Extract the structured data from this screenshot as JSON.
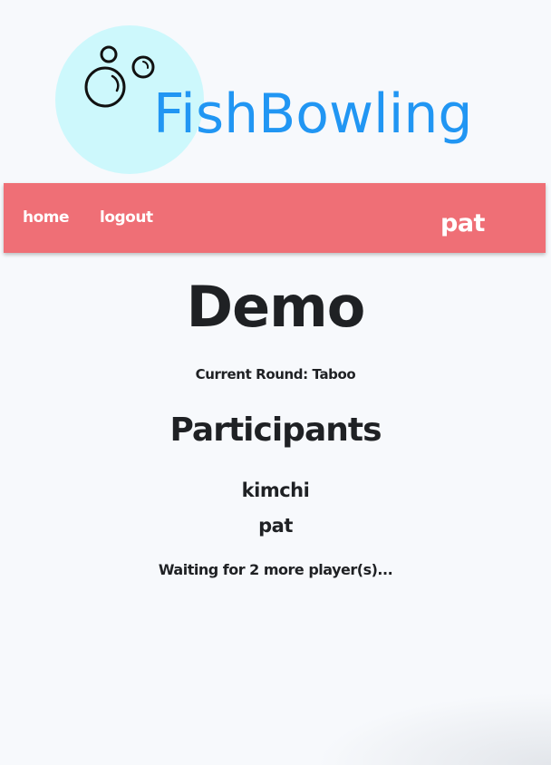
{
  "logo": {
    "text": "FishBowling",
    "icon": "bubbles-icon",
    "brand_color": "#2196f3",
    "circle_color": "#cdf8fc"
  },
  "nav": {
    "home_label": "home",
    "logout_label": "logout",
    "username": "pat",
    "bar_color": "#ef6f76"
  },
  "game": {
    "title": "Demo",
    "current_round": "Current Round: Taboo",
    "participants_heading": "Participants",
    "participants": [
      "kimchi",
      "pat"
    ],
    "status_text": "Waiting for 2 more player(s)..."
  }
}
